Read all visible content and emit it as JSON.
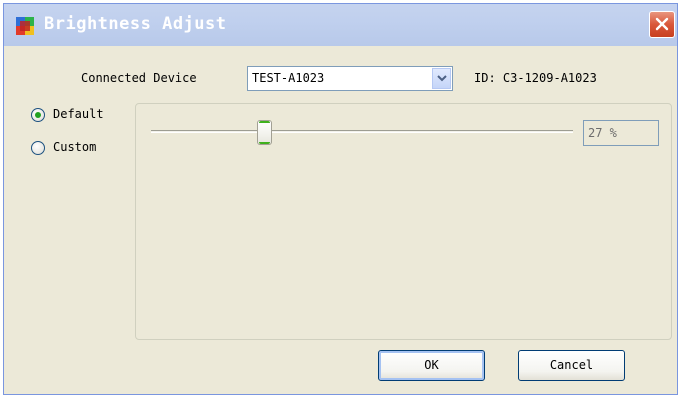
{
  "window": {
    "title": "Brightness Adjust"
  },
  "device": {
    "label": "Connected Device",
    "selected": "TEST-A1023",
    "id_text": "ID: C3-1209-A1023"
  },
  "modes": [
    {
      "label": "Default",
      "checked": true
    },
    {
      "label": "Custom",
      "checked": false
    }
  ],
  "brightness": {
    "value": 27,
    "display": "27 %",
    "min": 0,
    "max": 100
  },
  "buttons": {
    "ok": "OK",
    "cancel": "Cancel"
  },
  "colors": {
    "titlebar": "#c0d0ee",
    "dialog_bg": "#ece9d8",
    "close_btn": "#d9573a",
    "radio_dot": "#21a121",
    "thumb_accent": "#3fb11c"
  },
  "icons": {
    "app": "brightness-app-icon",
    "close": "close-icon",
    "dropdown": "chevron-down-icon"
  }
}
